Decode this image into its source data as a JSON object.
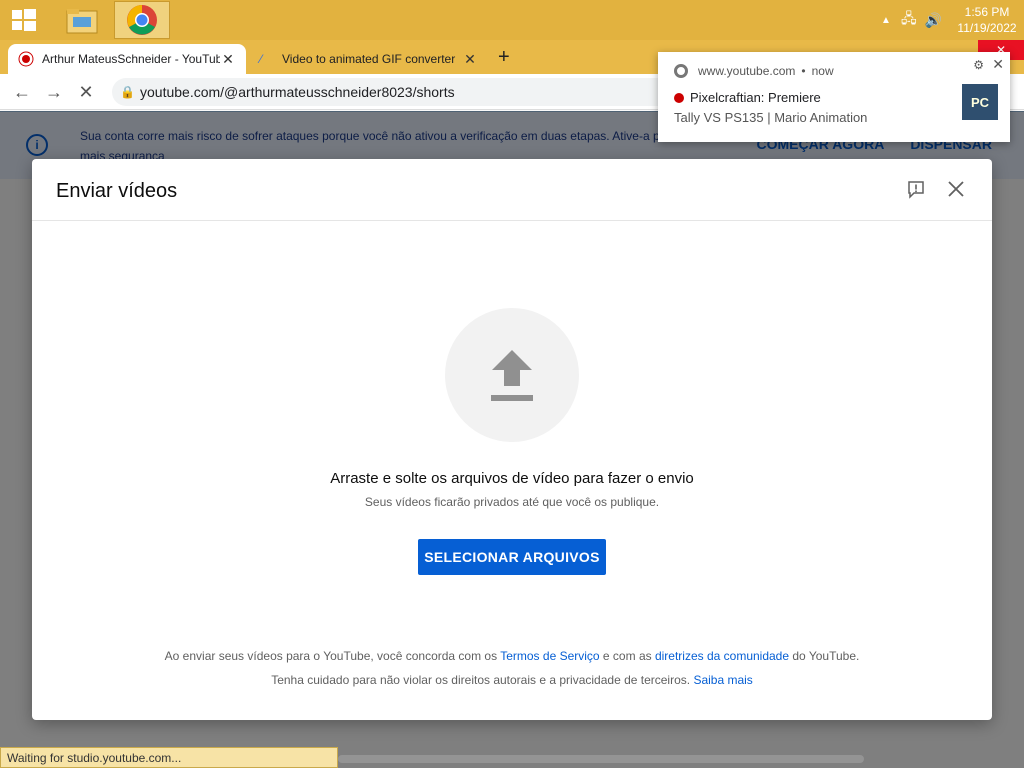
{
  "taskbar": {
    "clock_time": "1:56 PM",
    "clock_date": "11/19/2022"
  },
  "browser": {
    "tabs": [
      {
        "label": "Arthur MateusSchneider - YouTube",
        "active": true
      },
      {
        "label": "Video to animated GIF converter",
        "active": false
      }
    ],
    "url": "youtube.com/@arthurmateusschneider8023/shorts"
  },
  "banner": {
    "message": "Sua conta corre mais risco de sofrer ataques porque você não ativou a verificação em duas etapas. Ative-a para ter mais segurança",
    "action_start": "COMEÇAR AGORA",
    "action_dismiss": "DISPENSAR"
  },
  "notification": {
    "source": "www.youtube.com",
    "time": "now",
    "title": "Pixelcraftian: Premiere",
    "body": "Tally VS PS135 | Mario Animation",
    "thumb_text": "PC"
  },
  "dialog": {
    "title": "Enviar vídeos",
    "drop_text": "Arraste e solte os arquivos de vídeo para fazer o envio",
    "sub_text": "Seus vídeos ficarão privados até que você os publique.",
    "select_button": "SELECIONAR ARQUIVOS",
    "legal1_pre": "Ao enviar seus vídeos para o YouTube, você concorda com os ",
    "legal1_link1": "Termos de Serviço",
    "legal1_mid": " e com as ",
    "legal1_link2": "diretrizes da comunidade",
    "legal1_post": " do YouTube.",
    "legal2_pre": "Tenha cuidado para não violar os direitos autorais e a privacidade de terceiros. ",
    "legal2_link": "Saiba mais"
  },
  "status_bar": {
    "text": "Waiting for studio.youtube.com..."
  }
}
